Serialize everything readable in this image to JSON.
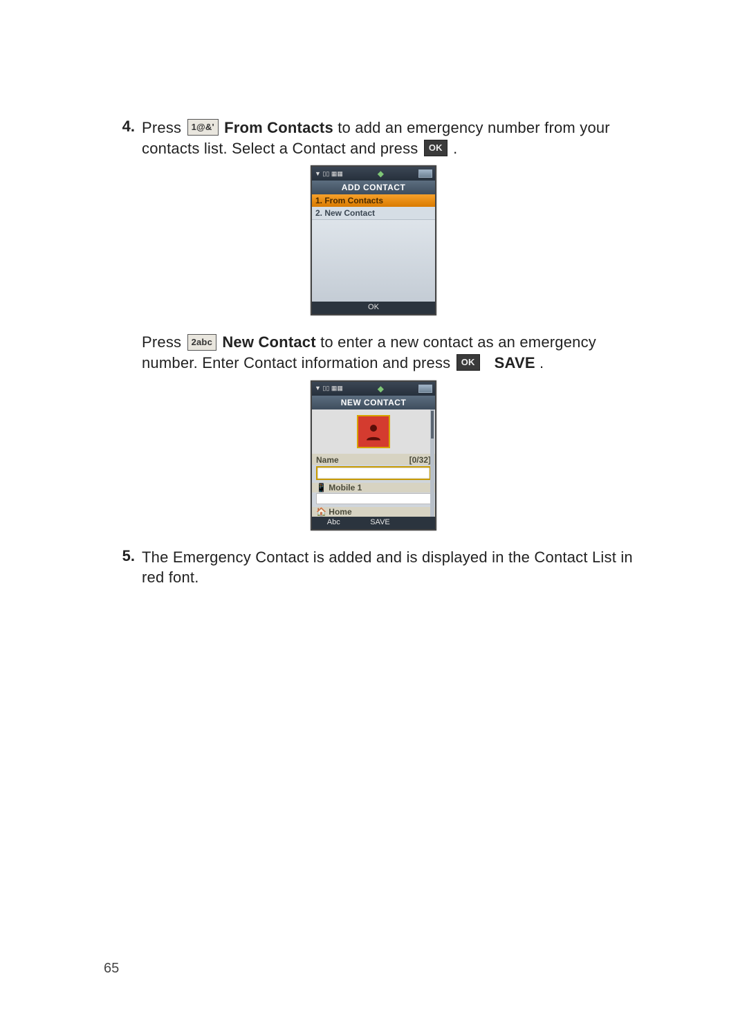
{
  "steps": {
    "s4": {
      "num": "4.",
      "lead": "Press ",
      "key1": "1@&'",
      "boldA": "From Contacts",
      "restA": " to add an emergency number from your contacts list. Select a Contact and press ",
      "okA": "OK",
      "restA2": ".",
      "lead2": "Press ",
      "key2": "2abc",
      "boldB": "New Contact",
      "restB": " to enter a new contact as an emergency number. Enter Contact information and press ",
      "okB": "OK",
      "boldSave": "SAVE",
      "restB2": "."
    },
    "s5": {
      "num": "5.",
      "text": "The Emergency Contact is added and is displayed in the Contact List in red font."
    }
  },
  "phone1": {
    "statusLeft": "▼ ▯▯ ▦▦",
    "title": "ADD CONTACT",
    "rowSel": "1. From Contacts",
    "row2": "2. New Contact",
    "softCenter": "OK"
  },
  "phone2": {
    "statusLeft": "▼ ▯▯ ▦▦",
    "title": "NEW CONTACT",
    "nameLabel": "Name",
    "nameCount": "[0/32]",
    "mobile": "Mobile 1",
    "home": "Home",
    "softLeft": "Abc",
    "softCenter": "SAVE"
  },
  "pageNumber": "65"
}
